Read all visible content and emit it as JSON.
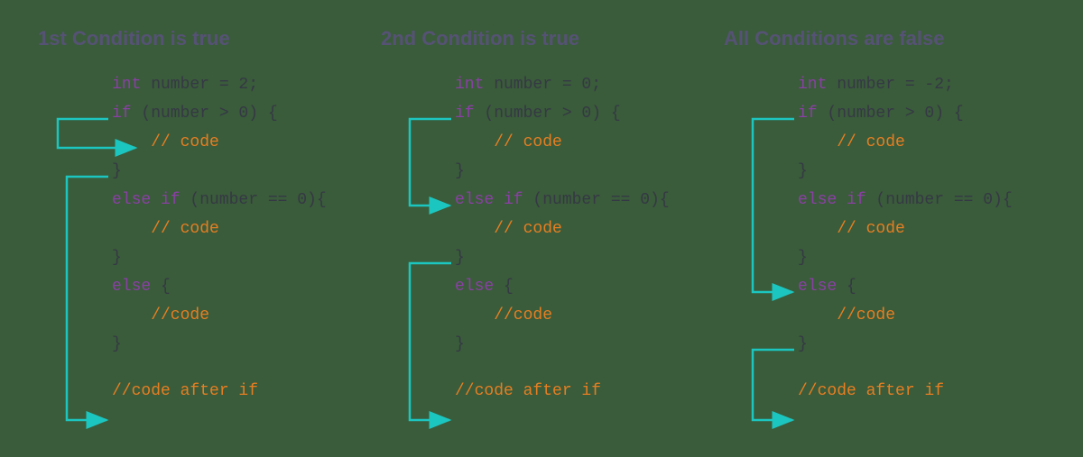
{
  "panels": [
    {
      "title": "1st Condition is true",
      "decl_kw": "int",
      "decl_rest": " number = 2;",
      "if_kw": "if",
      "if_cond": " (number > 0) {",
      "if_body": "    // code",
      "close1": "}",
      "elseif_kw": "else if",
      "elseif_cond": " (number == 0){",
      "elseif_body": "    // code",
      "close2": "}",
      "else_kw": "else",
      "else_rest": " {",
      "else_body": "    //code",
      "close3": "}",
      "after": "//code after if"
    },
    {
      "title": "2nd Condition is true",
      "decl_kw": "int",
      "decl_rest": " number = 0;",
      "if_kw": "if",
      "if_cond": " (number > 0) {",
      "if_body": "    // code",
      "close1": "}",
      "elseif_kw": "else if",
      "elseif_cond": " (number == 0){",
      "elseif_body": "    // code",
      "close2": "}",
      "else_kw": "else",
      "else_rest": " {",
      "else_body": "    //code",
      "close3": "}",
      "after": "//code after if"
    },
    {
      "title": "All Conditions are false",
      "decl_kw": "int",
      "decl_rest": " number = -2;",
      "if_kw": "if",
      "if_cond": " (number > 0) {",
      "if_body": "    // code",
      "close1": "}",
      "elseif_kw": "else if",
      "elseif_cond": " (number == 0){",
      "elseif_body": "    // code",
      "close2": "}",
      "else_kw": "else",
      "else_rest": " {",
      "else_body": "    //code",
      "close3": "}",
      "after": "//code after if"
    }
  ],
  "colors": {
    "arrow": "#1cc6c0"
  }
}
